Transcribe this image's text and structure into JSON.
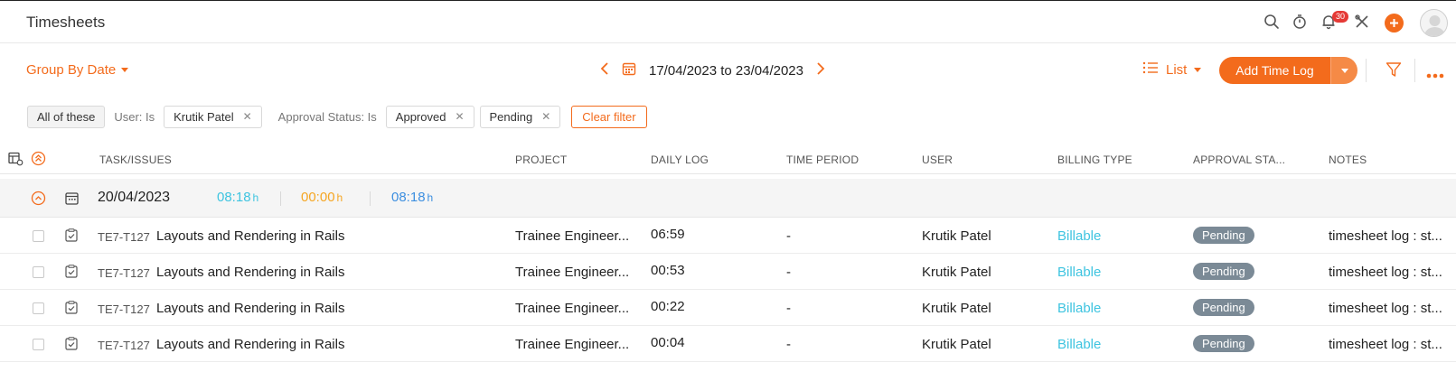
{
  "header": {
    "title": "Timesheets",
    "notification_count": "30",
    "icons": [
      "search-icon",
      "timer-icon",
      "bell-icon",
      "tools-icon",
      "plus-icon",
      "avatar"
    ]
  },
  "toolbar": {
    "group_by": "Group By Date",
    "date_range": "17/04/2023 to 23/04/2023",
    "view": "List",
    "add_button": "Add Time Log"
  },
  "filters": {
    "match": "All of these",
    "user_label": "User: Is",
    "user_value": "Krutik Patel",
    "approval_label": "Approval Status: Is",
    "approval_values": [
      "Approved",
      "Pending"
    ],
    "clear": "Clear filter"
  },
  "table": {
    "columns": [
      "TASK/ISSUES",
      "PROJECT",
      "DAILY LOG",
      "TIME PERIOD",
      "USER",
      "BILLING TYPE",
      "APPROVAL STA...",
      "NOTES"
    ],
    "group": {
      "date": "20/04/2023",
      "billable_total": "08:18",
      "non_billable_total": "00:00",
      "total": "08:18",
      "unit": "h"
    },
    "rows": [
      {
        "task_id": "TE7-T127",
        "task": "Layouts and Rendering in Rails",
        "project": "Trainee Engineer...",
        "daily_log": "06:59",
        "time_period": "-",
        "user": "Krutik Patel",
        "billing": "Billable",
        "status": "Pending",
        "notes": "timesheet log : st..."
      },
      {
        "task_id": "TE7-T127",
        "task": "Layouts and Rendering in Rails",
        "project": "Trainee Engineer...",
        "daily_log": "00:53",
        "time_period": "-",
        "user": "Krutik Patel",
        "billing": "Billable",
        "status": "Pending",
        "notes": "timesheet log : st..."
      },
      {
        "task_id": "TE7-T127",
        "task": "Layouts and Rendering in Rails",
        "project": "Trainee Engineer...",
        "daily_log": "00:22",
        "time_period": "-",
        "user": "Krutik Patel",
        "billing": "Billable",
        "status": "Pending",
        "notes": "timesheet log : st..."
      },
      {
        "task_id": "TE7-T127",
        "task": "Layouts and Rendering in Rails",
        "project": "Trainee Engineer...",
        "daily_log": "00:04",
        "time_period": "-",
        "user": "Krutik Patel",
        "billing": "Billable",
        "status": "Pending",
        "notes": "timesheet log : st..."
      }
    ]
  },
  "colors": {
    "accent": "#f36b1c",
    "billable": "#3ec4e0",
    "non_billable": "#f5a623",
    "total": "#3d8fe0",
    "status_pending": "#7b8a96"
  }
}
